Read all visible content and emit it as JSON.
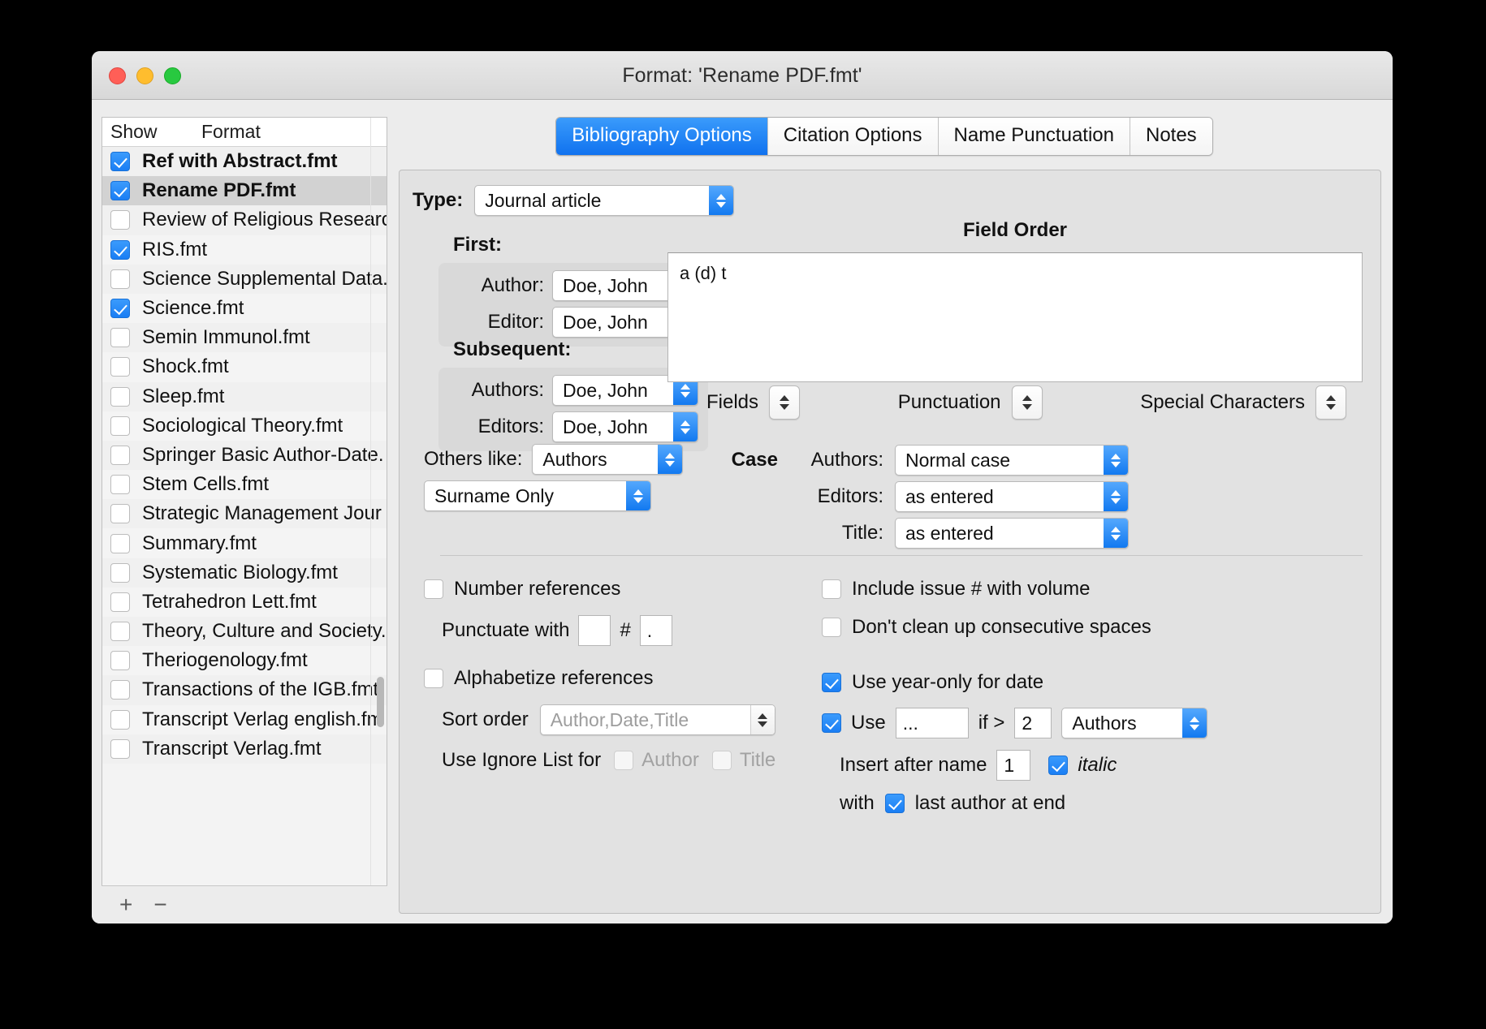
{
  "window": {
    "title": "Format: 'Rename PDF.fmt'",
    "traffic_lights": [
      "close-button",
      "minimize-button",
      "zoom-button"
    ]
  },
  "left_pane": {
    "columns": {
      "show": "Show",
      "format": "Format"
    },
    "footer": {
      "add": "+",
      "remove": "−"
    },
    "items": [
      {
        "label": "Ref with Abstract.fmt",
        "checked": true,
        "bold": true,
        "selected": false
      },
      {
        "label": "Rename PDF.fmt",
        "checked": true,
        "bold": true,
        "selected": true
      },
      {
        "label": "Review of Religious Researc",
        "checked": false,
        "bold": false,
        "selected": false
      },
      {
        "label": "RIS.fmt",
        "checked": true,
        "bold": false,
        "selected": false
      },
      {
        "label": "Science Supplemental Data.",
        "checked": false,
        "bold": false,
        "selected": false
      },
      {
        "label": "Science.fmt",
        "checked": true,
        "bold": false,
        "selected": false
      },
      {
        "label": "Semin Immunol.fmt",
        "checked": false,
        "bold": false,
        "selected": false
      },
      {
        "label": "Shock.fmt",
        "checked": false,
        "bold": false,
        "selected": false
      },
      {
        "label": "Sleep.fmt",
        "checked": false,
        "bold": false,
        "selected": false
      },
      {
        "label": "Sociological Theory.fmt",
        "checked": false,
        "bold": false,
        "selected": false
      },
      {
        "label": "Springer Basic Author-Date.",
        "checked": false,
        "bold": false,
        "selected": false
      },
      {
        "label": "Stem Cells.fmt",
        "checked": false,
        "bold": false,
        "selected": false
      },
      {
        "label": "Strategic Management Jour",
        "checked": false,
        "bold": false,
        "selected": false
      },
      {
        "label": "Summary.fmt",
        "checked": false,
        "bold": false,
        "selected": false
      },
      {
        "label": "Systematic Biology.fmt",
        "checked": false,
        "bold": false,
        "selected": false
      },
      {
        "label": "Tetrahedron Lett.fmt",
        "checked": false,
        "bold": false,
        "selected": false
      },
      {
        "label": "Theory, Culture and Society.",
        "checked": false,
        "bold": false,
        "selected": false
      },
      {
        "label": "Theriogenology.fmt",
        "checked": false,
        "bold": false,
        "selected": false
      },
      {
        "label": "Transactions of the IGB.fmt",
        "checked": false,
        "bold": false,
        "selected": false
      },
      {
        "label": "Transcript Verlag english.fm",
        "checked": false,
        "bold": false,
        "selected": false
      },
      {
        "label": "Transcript Verlag.fmt",
        "checked": false,
        "bold": false,
        "selected": false
      }
    ]
  },
  "tabs": [
    {
      "label": "Bibliography Options",
      "active": true
    },
    {
      "label": "Citation Options",
      "active": false
    },
    {
      "label": "Name Punctuation",
      "active": false
    },
    {
      "label": "Notes",
      "active": false
    }
  ],
  "form": {
    "type_label": "Type:",
    "type_value": "Journal article",
    "first_label": "First:",
    "first_author_label": "Author:",
    "first_author_value": "Doe, John",
    "first_editor_label": "Editor:",
    "first_editor_value": "Doe, John",
    "subsequent_label": "Subsequent:",
    "subsequent_authors_label": "Authors:",
    "subsequent_authors_value": "Doe, John",
    "subsequent_editors_label": "Editors:",
    "subsequent_editors_value": "Doe, John",
    "others_like_label": "Others like:",
    "others_like_value": "Authors",
    "surname_value": "Surname Only",
    "field_order_title": "Field Order",
    "field_order_content": "a (d) t",
    "fields_label": "Fields",
    "punctuation_label": "Punctuation",
    "special_characters_label": "Special Characters",
    "case_label": "Case",
    "case_authors_label": "Authors:",
    "case_authors_value": "Normal case",
    "case_editors_label": "Editors:",
    "case_editors_value": "as entered",
    "case_title_label": "Title:",
    "case_title_value": "as entered"
  },
  "options_left": {
    "number_references_label": "Number references",
    "number_references_checked": false,
    "punctuate_with_label": "Punctuate with",
    "punctuate_prefix_value": "",
    "punctuate_hash": "#",
    "punctuate_suffix_value": ".",
    "alphabetize_label": "Alphabetize references",
    "alphabetize_checked": false,
    "sort_order_label": "Sort order",
    "sort_order_value": "Author,Date,Title",
    "ignore_list_label": "Use Ignore List for",
    "ignore_author_label": "Author",
    "ignore_author_checked": false,
    "ignore_title_label": "Title",
    "ignore_title_checked": false
  },
  "options_right": {
    "include_issue_label": "Include issue # with volume",
    "include_issue_checked": false,
    "dont_clean_label": "Don't clean up consecutive spaces",
    "dont_clean_checked": false,
    "year_only_label": "Use year-only for date",
    "year_only_checked": true,
    "use_label": "Use",
    "use_checked": true,
    "use_value": "...",
    "if_gt_label": "if >",
    "if_gt_value": "2",
    "use_target_value": "Authors",
    "insert_after_label": "Insert after name",
    "insert_after_value": "1",
    "italic_label": "italic",
    "italic_checked": true,
    "with_label": "with",
    "last_author_label": "last author at end",
    "last_author_checked": true
  },
  "colors": {
    "accent_blue": "#1c7ef0",
    "window_bg": "#ececec",
    "panel_bg": "#e2e2e2",
    "selected_row": "#d2d2d2"
  }
}
